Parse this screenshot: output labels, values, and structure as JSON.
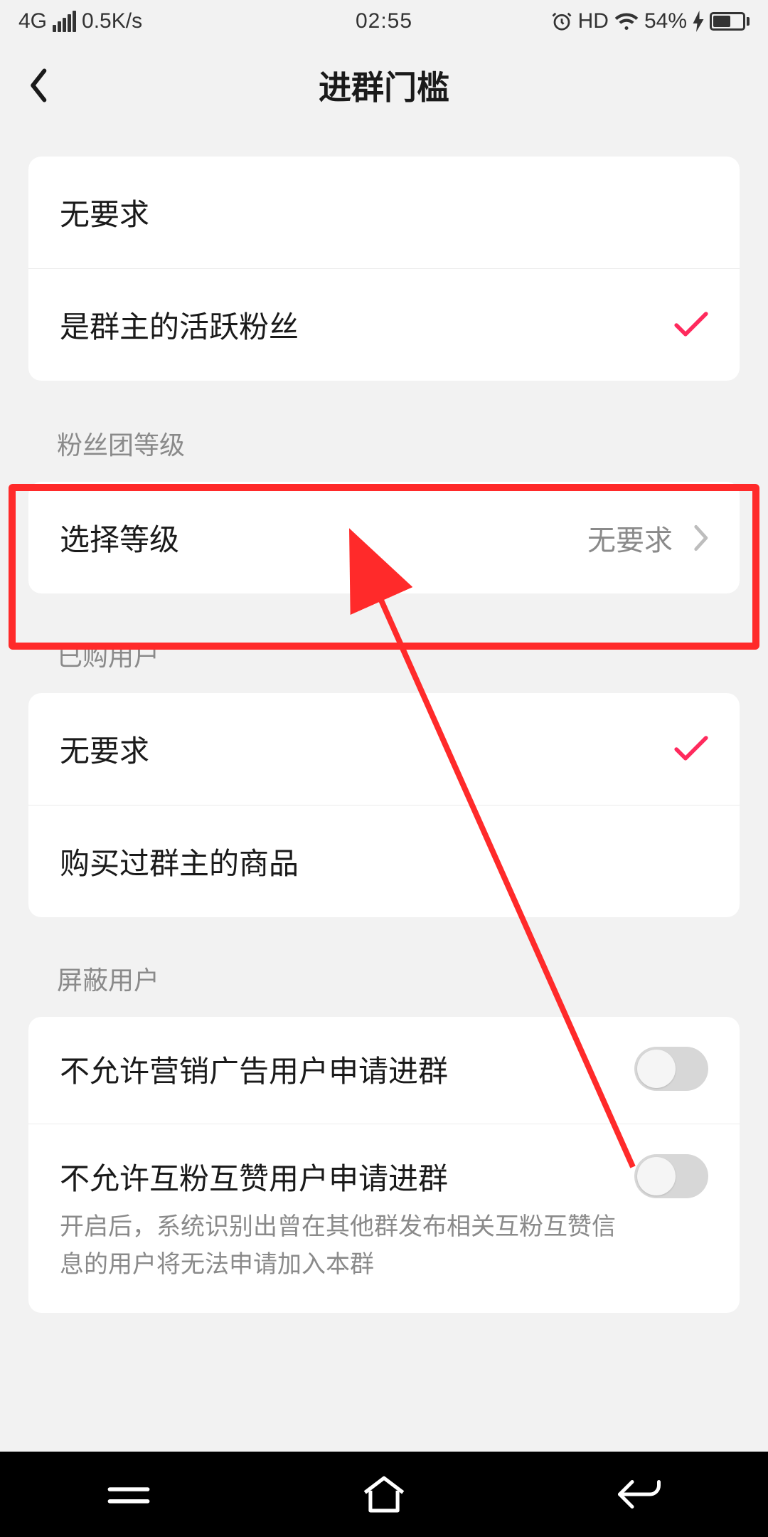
{
  "status_bar": {
    "network_type": "4G",
    "speed": "0.5K/s",
    "time": "02:55",
    "hd": "HD",
    "battery_pct": "54%"
  },
  "header": {
    "title": "进群门槛"
  },
  "sections": {
    "basic": {
      "no_requirement": "无要求",
      "active_fan": "是群主的活跃粉丝"
    },
    "fan_level": {
      "section_label": "粉丝团等级",
      "select_level_label": "选择等级",
      "select_level_value": "无要求"
    },
    "purchased": {
      "section_label": "已购用户",
      "no_requirement": "无要求",
      "bought_goods": "购买过群主的商品"
    },
    "blocked": {
      "section_label": "屏蔽用户",
      "block_ads_label": "不允许营销广告用户申请进群",
      "block_mutual_label": "不允许互粉互赞用户申请进群",
      "block_mutual_desc": "开启后，系统识别出曾在其他群发布相关互粉互赞信息的用户将无法申请加入本群"
    }
  },
  "colors": {
    "accent": "#ff2a5d",
    "annotation": "#ff2a2a"
  }
}
